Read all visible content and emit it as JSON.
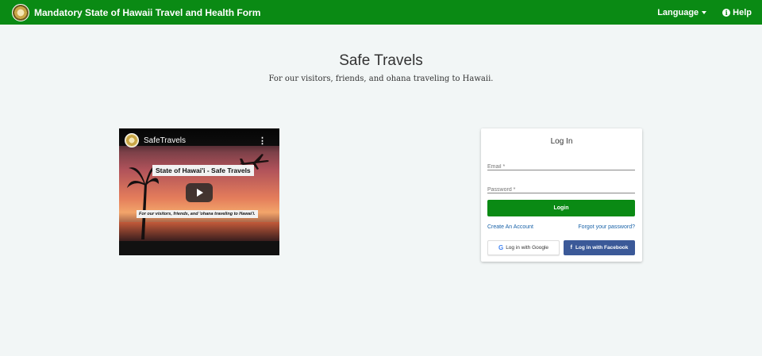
{
  "header": {
    "title": "Mandatory State of Hawaii Travel and Health Form",
    "language_label": "Language",
    "help_label": "Help"
  },
  "hero": {
    "title": "Safe Travels",
    "subtitle": "For our visitors, friends, and ohana traveling to Hawaii."
  },
  "video": {
    "channel": "SafeTravels",
    "menu": "⋮",
    "caption_title": "State of Hawai'i - Safe Travels",
    "caption_sub": "For our visitors, friends, and 'ohana traveling to Hawai'i."
  },
  "login": {
    "title": "Log In",
    "email_placeholder": "Email *",
    "password_placeholder": "Password *",
    "login_button": "Login",
    "create_account": "Create An Account",
    "forgot_password": "Forgot your password?",
    "google_button": "Log in with Google",
    "google_icon": "G",
    "facebook_button": "Log in with Facebook",
    "facebook_icon": "f"
  },
  "colors": {
    "brand_green": "#0a8a14",
    "facebook_blue": "#3b5998",
    "link_blue": "#1a63a8"
  }
}
